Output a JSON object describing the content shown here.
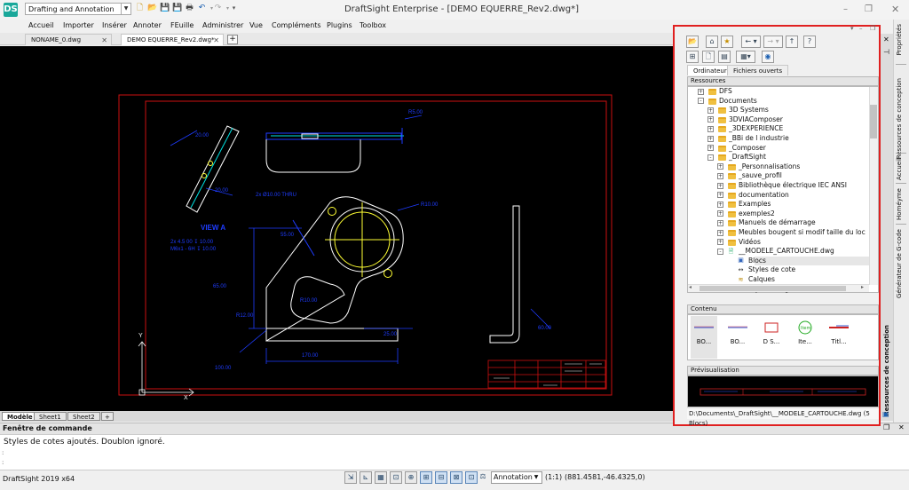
{
  "app": {
    "title": "DraftSight Enterprise - [DEMO EQUERRE_Rev2.dwg*]",
    "logo": "DS",
    "workspace": "Drafting and Annotation"
  },
  "menu": [
    "Accueil",
    "Importer",
    "Insérer",
    "Annoter",
    "FEuille",
    "Administrer",
    "Vue",
    "Compléments",
    "Plugins",
    "Toolbox"
  ],
  "doc_tabs": [
    {
      "label": "NONAME_0.dwg",
      "active": false
    },
    {
      "label": "DEMO EQUERRE_Rev2.dwg*",
      "active": true
    }
  ],
  "layout_tabs": [
    "Modèle",
    "Sheet1",
    "Sheet2"
  ],
  "drawing": {
    "view_label": "VIEW A",
    "dims": [
      "20.00",
      "20.00",
      "R5.00",
      "25.00",
      "R10.00",
      "65.00",
      "55.00",
      "R10.00",
      "R12.00",
      "30.00",
      "55.00",
      "170.00",
      "60.00",
      "R20.00",
      "27.00",
      "100.00",
      "R10.00",
      "R10.00"
    ],
    "notes": [
      "2x Ø10.00 THRU",
      "2x 4.5 00 ↧ 10.00",
      "M6x1 - 6H ↧ 10.00"
    ],
    "ucs_x": "X",
    "ucs_y": "Y"
  },
  "command": {
    "title": "Fenêtre de commande",
    "line1": "Styles de cotes ajoutés. Doublon ignoré.",
    "prompt1": ":",
    "prompt2": ":"
  },
  "status": {
    "version": "DraftSight 2019 x64",
    "annotation": "Annotation",
    "scale": "(1:1)",
    "coords": "(881.4581,-46.4325,0)"
  },
  "panel": {
    "tabs": [
      {
        "label": "Ordinateur",
        "active": true
      },
      {
        "label": "Fichiers ouverts",
        "active": false
      }
    ],
    "resources_header": "Ressources",
    "tree": [
      {
        "label": "DFS",
        "level": 0,
        "kind": "folder",
        "toggle": "+"
      },
      {
        "label": "Documents",
        "level": 0,
        "kind": "folder",
        "toggle": "-"
      },
      {
        "label": "3D Systems",
        "level": 1,
        "kind": "folder",
        "toggle": "+"
      },
      {
        "label": "3DVIAComposer",
        "level": 1,
        "kind": "folder",
        "toggle": "+"
      },
      {
        "label": "_3DEXPERIENCE",
        "level": 1,
        "kind": "folder",
        "toggle": "+"
      },
      {
        "label": "_BBi de l industrie",
        "level": 1,
        "kind": "folder",
        "toggle": "+"
      },
      {
        "label": "_Composer",
        "level": 1,
        "kind": "folder",
        "toggle": "+"
      },
      {
        "label": "_DraftSight",
        "level": 1,
        "kind": "folder",
        "toggle": "-"
      },
      {
        "label": "_Personnalisations",
        "level": 2,
        "kind": "folder",
        "toggle": "+"
      },
      {
        "label": "_sauve_profil",
        "level": 2,
        "kind": "folder",
        "toggle": "+"
      },
      {
        "label": "Bibliothèque électrique IEC ANSI",
        "level": 2,
        "kind": "folder",
        "toggle": "+"
      },
      {
        "label": "documentation",
        "level": 2,
        "kind": "folder",
        "toggle": "+"
      },
      {
        "label": "Examples",
        "level": 2,
        "kind": "folder",
        "toggle": "+"
      },
      {
        "label": "exemples2",
        "level": 2,
        "kind": "folder",
        "toggle": "+"
      },
      {
        "label": "Manuels de démarrage",
        "level": 2,
        "kind": "folder",
        "toggle": "+"
      },
      {
        "label": "Meubles bougent si modif taille du loc",
        "level": 2,
        "kind": "folder",
        "toggle": "+"
      },
      {
        "label": "Vidéos",
        "level": 2,
        "kind": "folder",
        "toggle": "+"
      },
      {
        "label": "__MODELE_CARTOUCHE.dwg",
        "level": 2,
        "kind": "dwg",
        "toggle": "-"
      },
      {
        "label": "Blocs",
        "level": 3,
        "kind": "blocks",
        "toggle": ""
      },
      {
        "label": "Styles de cote",
        "level": 3,
        "kind": "dimstyle",
        "toggle": ""
      },
      {
        "label": "Calques",
        "level": 3,
        "kind": "layers",
        "toggle": ""
      },
      {
        "label": "Styles de ligne",
        "level": 3,
        "kind": "linestyle",
        "toggle": ""
      }
    ],
    "content_header": "Contenu",
    "content_items": [
      "BO...",
      "BO...",
      "D S...",
      "Ite...",
      "Titl..."
    ],
    "preview_header": "Prévisualisation",
    "path": "D:\\Documents\\_DraftSight\\__MODELE_CARTOUCHE.dwg (5 Blocs)",
    "strip_label": "Ressources de conception"
  },
  "right_strip": [
    "Propriétés",
    "Ressources de conception",
    "Accueil",
    "Homéyme",
    "Générateur de G-code"
  ],
  "colors": {
    "accent_red": "#e02020",
    "drawing_bg": "#000000",
    "dim_blue": "#1e3cff",
    "cyan": "#00e5e5",
    "yellow": "#ffff33",
    "frame_red": "#cc1111"
  }
}
